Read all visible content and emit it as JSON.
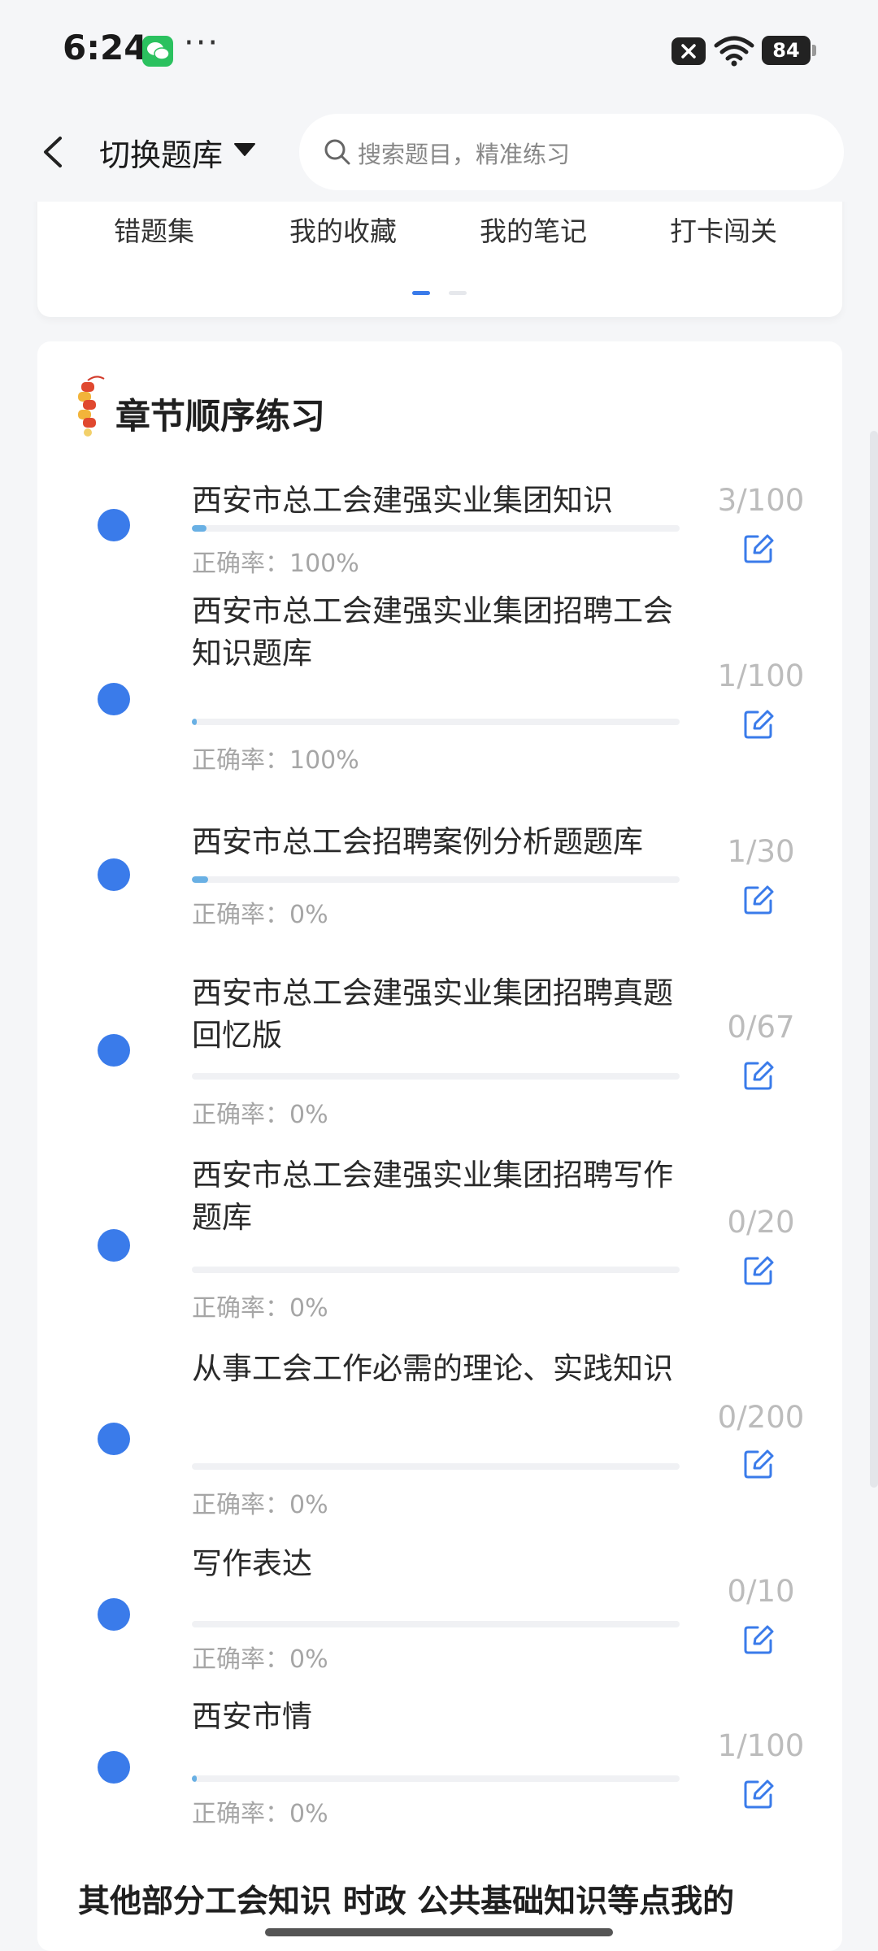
{
  "status": {
    "time": "6:24",
    "battery": "84"
  },
  "header": {
    "title": "切换题库",
    "search_placeholder": "搜索题目，精准练习"
  },
  "tabs": [
    "错题集",
    "我的收藏",
    "我的笔记",
    "打卡闯关"
  ],
  "section": {
    "title": "章节顺序练习"
  },
  "accuracy_label": "正确率：",
  "colors": {
    "accent": "#3a7bea",
    "progress": "#69b0e4"
  },
  "items": [
    {
      "title": "西安市总工会建强实业集团知识",
      "count": "3/100",
      "accuracy": "100%",
      "progress": 0.03
    },
    {
      "title": "西安市总工会建强实业集团招聘工会知识题库",
      "count": "1/100",
      "accuracy": "100%",
      "progress": 0.01
    },
    {
      "title": "西安市总工会招聘案例分析题题库",
      "count": "1/30",
      "accuracy": "0%",
      "progress": 0.033
    },
    {
      "title": "西安市总工会建强实业集团招聘真题回忆版",
      "count": "0/67",
      "accuracy": "0%",
      "progress": 0
    },
    {
      "title": "西安市总工会建强实业集团招聘写作题库",
      "count": "0/20",
      "accuracy": "0%",
      "progress": 0
    },
    {
      "title": "从事工会工作必需的理论、实践知识",
      "count": "0/200",
      "accuracy": "0%",
      "progress": 0
    },
    {
      "title": "写作表达",
      "count": "0/10",
      "accuracy": "0%",
      "progress": 0
    },
    {
      "title": "西安市情",
      "count": "1/100",
      "accuracy": "0%",
      "progress": 0.01
    }
  ],
  "footer_text": "其他部分工会知识 时政 公共基础知识等点我的"
}
